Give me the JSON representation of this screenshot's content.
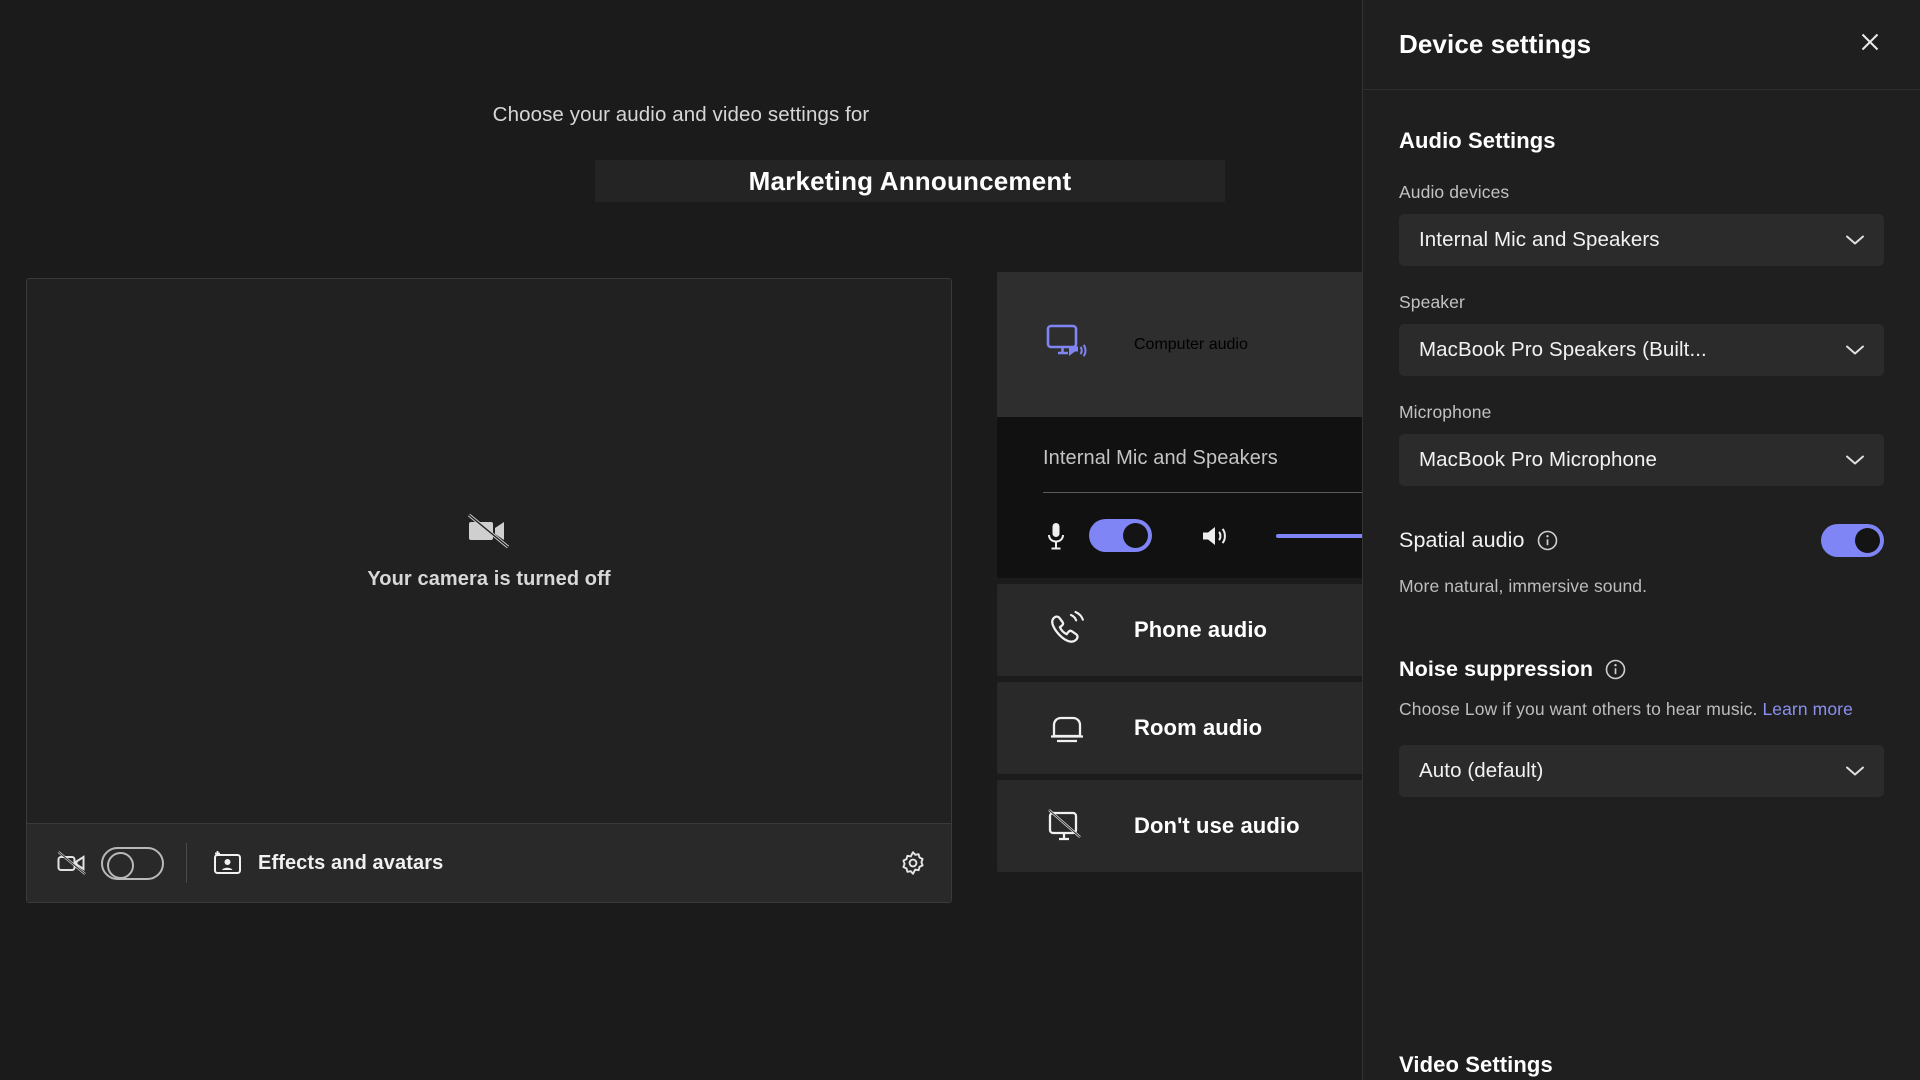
{
  "prejoin": {
    "subtitle": "Choose your audio and video settings for",
    "meeting_title": "Marketing Announcement",
    "camera": {
      "off_label": "Your camera is turned off",
      "toggle_state": "off"
    },
    "toolbar": {
      "effects_label": "Effects and avatars",
      "settings_icon": "gear-icon",
      "camera_icon": "camera-off-icon"
    },
    "audio_options": [
      {
        "id": "computer-audio",
        "label": "Computer audio",
        "icon": "monitor-speaker-icon",
        "selected": true,
        "device_name": "Internal Mic and Speakers",
        "mic_toggle_state": "on",
        "mic_icon": "microphone-icon",
        "speaker_icon": "speaker-icon",
        "volume_percent": 100
      },
      {
        "id": "phone-audio",
        "label": "Phone audio",
        "icon": "phone-ringing-icon",
        "selected": false
      },
      {
        "id": "room-audio",
        "label": "Room audio",
        "icon": "room-device-icon",
        "selected": false
      },
      {
        "id": "dont-use-audio",
        "label": "Don't use audio",
        "icon": "monitor-muted-icon",
        "selected": false
      }
    ]
  },
  "device_settings": {
    "title": "Device settings",
    "close_icon": "close-icon",
    "audio_section": {
      "heading": "Audio Settings",
      "audio_devices_label": "Audio devices",
      "audio_devices_value": "Internal Mic and Speakers",
      "speaker_label": "Speaker",
      "speaker_value": "MacBook Pro Speakers (Built...",
      "microphone_label": "Microphone",
      "microphone_value": "MacBook Pro Microphone",
      "spatial_audio_label": "Spatial audio",
      "spatial_audio_state": "on",
      "spatial_audio_help": "More natural, immersive sound.",
      "noise_suppression_label": "Noise suppression",
      "noise_suppression_help_prefix": "Choose Low if you want others to hear music. ",
      "noise_suppression_link": "Learn more",
      "noise_suppression_value": "Auto (default)"
    },
    "video_section": {
      "heading": "Video Settings"
    }
  },
  "colors": {
    "accent_purple": "#7f85f5",
    "link_purple": "#8b90f0",
    "panel_bg": "#1f1f1f",
    "app_bg": "#1b1b1b",
    "card_bg": "#292929",
    "field_bg": "#2b2b2b"
  }
}
